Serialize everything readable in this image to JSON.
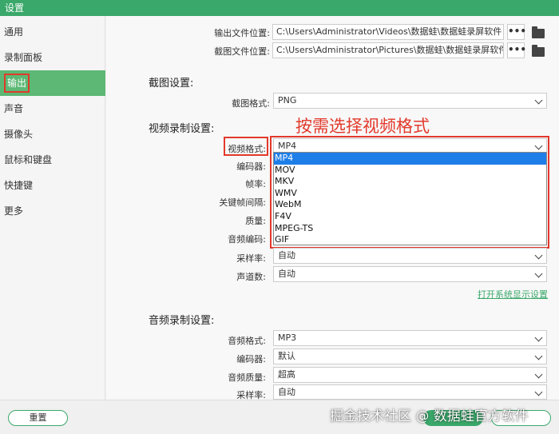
{
  "window": {
    "title": "设置"
  },
  "sidebar": {
    "items": [
      {
        "label": "通用"
      },
      {
        "label": "录制面板"
      },
      {
        "label": "输出"
      },
      {
        "label": "声音"
      },
      {
        "label": "摄像头"
      },
      {
        "label": "鼠标和键盘"
      },
      {
        "label": "快捷键"
      },
      {
        "label": "更多"
      }
    ],
    "active_index": 2
  },
  "output_paths": {
    "output_label": "输出文件位置:",
    "output_path": "C:\\Users\\Administrator\\Videos\\数据蛙\\数据蛙录屏软件",
    "screenshot_label": "截图文件位置:",
    "screenshot_path": "C:\\Users\\Administrator\\Pictures\\数据蛙\\数据蛙录屏软件",
    "browse_label": "•••"
  },
  "screenshot_settings": {
    "title": "截图设置:",
    "format_label": "截图格式:",
    "format_value": "PNG"
  },
  "video_settings": {
    "title": "视频录制设置:",
    "format_label": "视频格式:",
    "format_value": "MP4",
    "format_options": [
      "MP4",
      "MOV",
      "MKV",
      "WMV",
      "WebM",
      "F4V",
      "MPEG-TS",
      "GIF"
    ],
    "encoder_label": "编码器:",
    "framerate_label": "帧率:",
    "keyframe_label": "关键帧间隔:",
    "quality_label": "质量:",
    "audio_codec_label": "音频编码:",
    "sample_rate_label": "采样率:",
    "sample_rate_value": "自动",
    "channels_label": "声道数:",
    "channels_value": "自动",
    "open_display_link": "打开系统显示设置"
  },
  "annotation": {
    "text": "按需选择视频格式"
  },
  "audio_settings": {
    "title": "音频录制设置:",
    "format_label": "音频格式:",
    "format_value": "MP3",
    "encoder_label": "编码器:",
    "encoder_value": "默认",
    "quality_label": "音频质量:",
    "quality_value": "超高",
    "sample_rate_label": "采样率:",
    "sample_rate_value": "自动"
  },
  "footer": {
    "reset_label": "重置",
    "watermark": "掘金技术社区 @ 数据蛙官方软件"
  },
  "colors": {
    "accent": "#3aa86a",
    "highlight_red": "#e2392b",
    "dropdown_selected": "#1e7ee8"
  }
}
